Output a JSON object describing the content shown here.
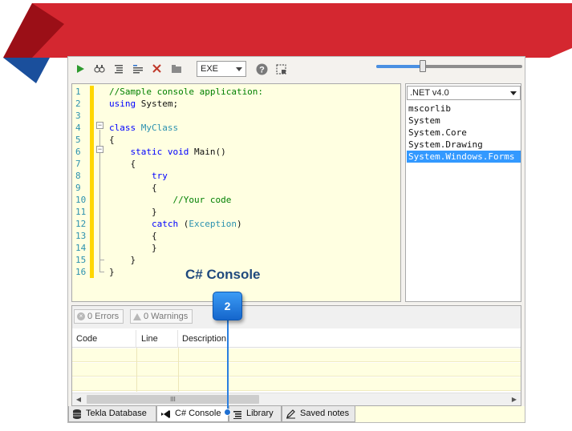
{
  "toolbar": {
    "run_icon": "play-icon",
    "output_type": "EXE",
    "zoom_fraction": 0.32
  },
  "editor": {
    "line_numbers": [
      "1",
      "2",
      "3",
      "4",
      "5",
      "6",
      "7",
      "8",
      "9",
      "10",
      "11",
      "12",
      "13",
      "14",
      "15",
      "16"
    ],
    "lines": [
      {
        "n": "1",
        "t": "//Sample console application:"
      },
      {
        "n": "2",
        "t": "using System;"
      },
      {
        "n": "3",
        "t": ""
      },
      {
        "n": "4",
        "t": "class MyClass"
      },
      {
        "n": "5",
        "t": "{"
      },
      {
        "n": "6",
        "t": "    static void Main()"
      },
      {
        "n": "7",
        "t": "    {"
      },
      {
        "n": "8",
        "t": "        try"
      },
      {
        "n": "9",
        "t": "        {"
      },
      {
        "n": "10",
        "t": "            //Your code"
      },
      {
        "n": "11",
        "t": "        }"
      },
      {
        "n": "12",
        "t": "        catch (Exception)"
      },
      {
        "n": "13",
        "t": "        {"
      },
      {
        "n": "14",
        "t": "        }"
      },
      {
        "n": "15",
        "t": "    }"
      },
      {
        "n": "16",
        "t": "}"
      }
    ],
    "tokens": {
      "comment1": "//Sample console application:",
      "using_kw": "using",
      "using_rest": " System;",
      "class_kw": "class",
      "class_name": "MyClass",
      "open_brace": "{",
      "close_brace": "}",
      "static_kw": "static",
      "void_kw": "void",
      "main_sig": " Main()",
      "try_kw": "try",
      "comment2": "//Your code",
      "catch_kw": "catch",
      "paren_open": " (",
      "exception_type": "Exception",
      "paren_close": ")"
    }
  },
  "references": {
    "framework": ".NET v4.0",
    "items": [
      "mscorlib",
      "System",
      "System.Core",
      "System.Drawing",
      "System.Windows.Forms"
    ],
    "selected_index": 4
  },
  "overlay_label": "C# Console",
  "errors": {
    "errors_label": "0 Errors",
    "warnings_label": "0 Warnings",
    "columns": [
      "Code",
      "Line",
      "Description"
    ],
    "scroll_grip": "III"
  },
  "tabs": [
    {
      "label": "Tekla Database",
      "icon": "database-icon"
    },
    {
      "label": "C# Console",
      "icon": "visual-studio-icon"
    },
    {
      "label": "Library",
      "icon": "library-icon"
    },
    {
      "label": "Saved notes",
      "icon": "pen-icon"
    }
  ],
  "callout": {
    "number": "2"
  },
  "colors": {
    "banner_red": "#d42730",
    "banner_dark_red": "#9b0f17",
    "banner_blue": "#1a4f9c",
    "editor_bg": "#ffffe1",
    "selection": "#3399ff",
    "callout_blue": "#2a7fe0"
  }
}
